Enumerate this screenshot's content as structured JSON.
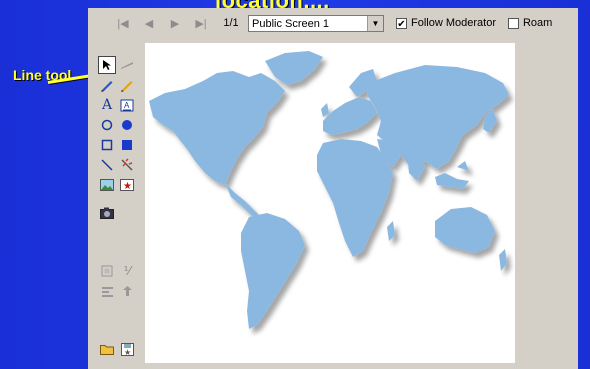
{
  "slide": {
    "title": "location....",
    "callout": "Line tool"
  },
  "toolbar": {
    "first_icon": "first-page-icon",
    "prev_icon": "prev-page-icon",
    "next_icon": "next-page-icon",
    "last_icon": "last-page-icon",
    "page_count": "1/1",
    "screen_select": "Public Screen 1",
    "follow_label": "Follow Moderator",
    "follow_checked": true,
    "roam_label": "Roam",
    "roam_checked": false
  },
  "colors": {
    "background": "#1f3ae8",
    "callout": "#ffff33",
    "map_land": "#8bb8e0",
    "panel": "#d4d0c8"
  },
  "tools": [
    "pointer-icon",
    "highlighter-icon",
    "line-pen-icon",
    "pencil-icon",
    "text-icon",
    "text-box-icon",
    "ellipse-outline-icon",
    "ellipse-filled-icon",
    "rectangle-outline-icon",
    "rectangle-filled-icon",
    "straight-line-icon",
    "magic-wand-icon",
    "image-icon",
    "stamp-icon",
    "camera-icon",
    "copy-icon",
    "scale-icon",
    "align-left-icon",
    "align-up-icon",
    "open-folder-icon",
    "save-icon"
  ]
}
